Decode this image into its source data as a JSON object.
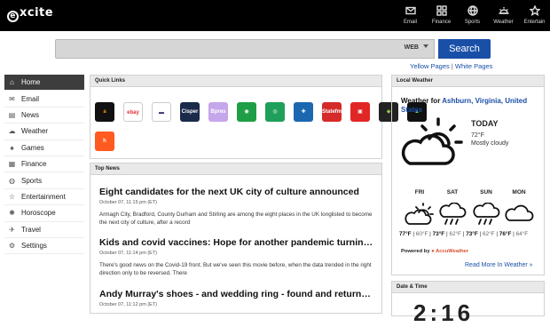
{
  "brand": {
    "logo_text": "xcite",
    "logo_ring": "e"
  },
  "topnav": [
    {
      "label": "Email",
      "icon": "mail-icon"
    },
    {
      "label": "Finance",
      "icon": "grid-icon"
    },
    {
      "label": "Sports",
      "icon": "ball-icon"
    },
    {
      "label": "Weather",
      "icon": "sun-icon"
    },
    {
      "label": "Entertain",
      "icon": "star-icon"
    }
  ],
  "search": {
    "scope": "WEB",
    "button": "Search",
    "placeholder": ""
  },
  "dirlinks": {
    "yellow": "Yellow Pages",
    "sep": "|",
    "white": "White Pages"
  },
  "sidebar": {
    "items": [
      {
        "label": "Home",
        "icon": "home-icon",
        "active": true
      },
      {
        "label": "Email",
        "icon": "mail-icon"
      },
      {
        "label": "News",
        "icon": "news-icon"
      },
      {
        "label": "Weather",
        "icon": "cloud-icon"
      },
      {
        "label": "Games",
        "icon": "gamepad-icon"
      },
      {
        "label": "Finance",
        "icon": "chart-icon"
      },
      {
        "label": "Sports",
        "icon": "ball-icon"
      },
      {
        "label": "Entertainment",
        "icon": "star-icon"
      },
      {
        "label": "Horoscope",
        "icon": "zodiac-icon"
      },
      {
        "label": "Travel",
        "icon": "plane-icon"
      },
      {
        "label": "Settings",
        "icon": "gear-icon"
      }
    ]
  },
  "quicklinks": {
    "header": "Quick Links",
    "items": [
      {
        "label": "a",
        "color": "#111111",
        "fg": "#ff9900"
      },
      {
        "label": "ebay",
        "color": "#ffffff",
        "fg": "#e53238"
      },
      {
        "label": "▬",
        "color": "#ffffff",
        "fg": "#2b2a72"
      },
      {
        "label": "Cisper",
        "color": "#1b2a4a",
        "fg": "#ffffff"
      },
      {
        "label": "Bpres",
        "color": "#c6a6ea",
        "fg": "#ffffff"
      },
      {
        "label": "◉",
        "color": "#1e9e47",
        "fg": "#ffffff"
      },
      {
        "label": "◎",
        "color": "#1fa05a",
        "fg": "#ffffff"
      },
      {
        "label": "✚",
        "color": "#1d67b0",
        "fg": "#ffffff"
      },
      {
        "label": "Statefm",
        "color": "#d42a2a",
        "fg": "#ffffff"
      },
      {
        "label": "▣",
        "color": "#e12626",
        "fg": "#ffffff"
      },
      {
        "label": "◆",
        "color": "#222222",
        "fg": "#8dc63f"
      },
      {
        "label": "▲",
        "color": "#111111",
        "fg": "#6bd06b"
      },
      {
        "label": "h",
        "color": "#ff5a1f",
        "fg": "#ffffff"
      }
    ]
  },
  "news": {
    "header": "Top News",
    "items": [
      {
        "title": "Eight candidates for the next UK city of culture announced",
        "date": "October 07, 11:15 pm (ET)",
        "summary": "Armagh City, Bradford, County Durham and Stirling are among the eight places in the UK longlisted to become the next city of culture, after a record"
      },
      {
        "title": "Kids and covid vaccines: Hope for another pandemic turning point",
        "date": "October 07, 11:14 pm (ET)",
        "summary": "There's good news on the Covid-19 front. But we've seen this movie before, when the data trended in the right direction only to be reversed. There"
      },
      {
        "title": "Andy Murray's shoes - and wedding ring - found and returned at",
        "date": "October 07, 11:12 pm (ET)",
        "summary": ""
      }
    ]
  },
  "weather": {
    "header": "Local Weather",
    "for_prefix": "Weather for",
    "location": "Ashburn, Virginia, United States",
    "today_label": "TODAY",
    "today_temp": "72°F",
    "today_cond": "Mostly cloudy",
    "forecast": [
      {
        "day": "FRI",
        "hi": "77°F",
        "lo": "60°F",
        "icon": "partly-cloudy-icon"
      },
      {
        "day": "SAT",
        "hi": "73°F",
        "lo": "62°F",
        "icon": "rain-icon"
      },
      {
        "day": "SUN",
        "hi": "73°F",
        "lo": "62°F",
        "icon": "rain-icon"
      },
      {
        "day": "MON",
        "hi": "76°F",
        "lo": "64°F",
        "icon": "cloud-icon"
      }
    ],
    "powered_prefix": "Powered by",
    "powered_brand": "AccuWeather",
    "more": "Read More In Weather »"
  },
  "datetime": {
    "header": "Date & Time",
    "clock": "2:16"
  }
}
